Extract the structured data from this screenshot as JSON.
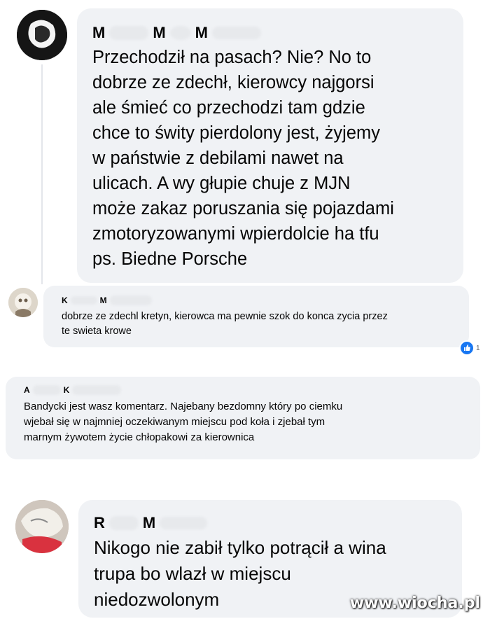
{
  "comments": [
    {
      "author_initials": [
        "M",
        "M",
        "M"
      ],
      "text": "Przechodził na pasach? Nie? No to\ndobrze ze zdechł, kierowcy najgorsi\nale śmieć co przechodzi tam gdzie\nchce to świty pierdolony jest, żyjemy\nw państwie z debilami nawet na\nulicach. A wy głupie chuje z MJN\nmoże zakaz poruszania się pojazdami\nzmotoryzowanymi wpierdolcie ha tfu\nps. Biedne Porsche"
    },
    {
      "author_initials": [
        "K",
        "M"
      ],
      "text": "dobrze ze zdechl kretyn, kierowca ma pewnie szok do konca zycia przez\nte swieta krowe",
      "reaction_count": "1"
    },
    {
      "author_initials": [
        "A",
        "K"
      ],
      "text": "Bandycki jest wasz komentarz. Najebany bezdomny który po ciemku\nwjebał się w najmniej oczekiwanym miejscu pod koła i zjebał tym\nmarnym żywotem życie chłopakowi za kierownica"
    },
    {
      "author_initials": [
        "R",
        "M"
      ],
      "text": "Nikogo nie zabił tylko potrącił a wina\ntrupa bo wlazł w miejscu\nniedozwolonym"
    }
  ],
  "watermark": "www.wiocha.pl",
  "colors": {
    "bubble": "#f0f2f5",
    "like": "#1877f2"
  }
}
